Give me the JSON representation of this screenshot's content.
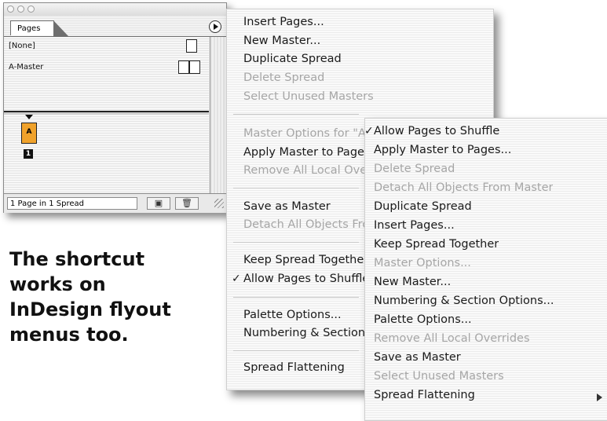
{
  "palette": {
    "window_title": "",
    "tab_label": "Pages",
    "masters": [
      "[None]",
      "A-Master"
    ],
    "page_prefix": "A",
    "page_number": "1",
    "status": "1 Page in 1 Spread"
  },
  "caption": [
    "The shortcut",
    "works on",
    "InDesign flyout",
    "menus too."
  ],
  "menu_default": [
    {
      "label": "Insert Pages...",
      "enabled": true
    },
    {
      "label": "New Master...",
      "enabled": true
    },
    {
      "label": "Duplicate Spread",
      "enabled": true
    },
    {
      "label": "Delete Spread",
      "enabled": false
    },
    {
      "label": "Select Unused Masters",
      "enabled": false
    },
    {
      "label": "Master Options for \"A-Master\"...",
      "enabled": false
    },
    {
      "label": "Apply Master to Pages...",
      "enabled": true
    },
    {
      "label": "Remove All Local Overrides",
      "enabled": false
    },
    {
      "label": "Save as Master",
      "enabled": true
    },
    {
      "label": "Detach All Objects From Master",
      "enabled": false
    },
    {
      "label": "Keep Spread Together",
      "enabled": true
    },
    {
      "label": "Allow Pages to Shuffle",
      "enabled": true,
      "checked": true
    },
    {
      "label": "Palette Options...",
      "enabled": true
    },
    {
      "label": "Numbering & Section Options...",
      "enabled": true
    },
    {
      "label": "Spread Flattening",
      "enabled": true
    }
  ],
  "menu_sorted": [
    {
      "label": "Allow Pages to Shuffle",
      "enabled": true,
      "checked": true
    },
    {
      "label": "Apply Master to Pages...",
      "enabled": true
    },
    {
      "label": "Delete Spread",
      "enabled": false
    },
    {
      "label": "Detach All Objects From Master",
      "enabled": false
    },
    {
      "label": "Duplicate Spread",
      "enabled": true
    },
    {
      "label": "Insert Pages...",
      "enabled": true
    },
    {
      "label": "Keep Spread Together",
      "enabled": true
    },
    {
      "label": "Master Options...",
      "enabled": false
    },
    {
      "label": "New Master...",
      "enabled": true
    },
    {
      "label": "Numbering & Section Options...",
      "enabled": true
    },
    {
      "label": "Palette Options...",
      "enabled": true
    },
    {
      "label": "Remove All Local Overrides",
      "enabled": false
    },
    {
      "label": "Save as Master",
      "enabled": true
    },
    {
      "label": "Select Unused Masters",
      "enabled": false
    },
    {
      "label": "Spread Flattening",
      "enabled": true,
      "submenu": true
    }
  ],
  "icons": {
    "palette_menu": "flyout-menu-icon",
    "new_page": "new-page-icon",
    "delete": "trash-icon",
    "resize": "resize-grip-icon",
    "check": "checkmark-icon",
    "submenu": "submenu-arrow-icon"
  },
  "colors": {
    "master_page": "#f0a22b",
    "disabled_text": "#a6a6a6"
  }
}
